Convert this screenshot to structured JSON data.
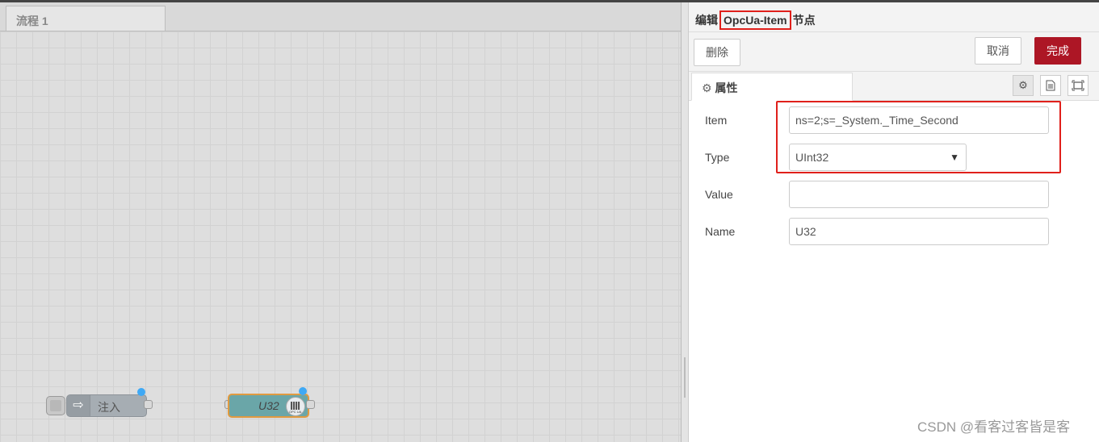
{
  "workspace": {
    "tab_label": "流程 1",
    "nodes": {
      "inject": {
        "label": "注入"
      },
      "opc_item": {
        "label": "U32",
        "icon_text": "OPC UA"
      }
    }
  },
  "editor": {
    "title_prefix": "编辑",
    "title_node_type": "OpcUa-Item",
    "title_suffix": "节点",
    "buttons": {
      "delete": "删除",
      "cancel": "取消",
      "done": "完成"
    },
    "tabs": {
      "properties": "属性"
    },
    "tab_icons": [
      "gear-icon",
      "document-icon",
      "frame-icon"
    ],
    "form": {
      "item": {
        "label": "Item",
        "value": "ns=2;s=_System._Time_Second"
      },
      "type": {
        "label": "Type",
        "value": "UInt32"
      },
      "value": {
        "label": "Value",
        "value": ""
      },
      "name": {
        "label": "Name",
        "value": "U32"
      }
    }
  },
  "watermark": "CSDN @看客过客皆是客",
  "colors": {
    "done_button": "#ad1625",
    "highlight_box": "#e0201b",
    "opc_node": "#6aa6a8",
    "inject_node": "#a6adb3",
    "status_dot": "#3fa9f5"
  }
}
